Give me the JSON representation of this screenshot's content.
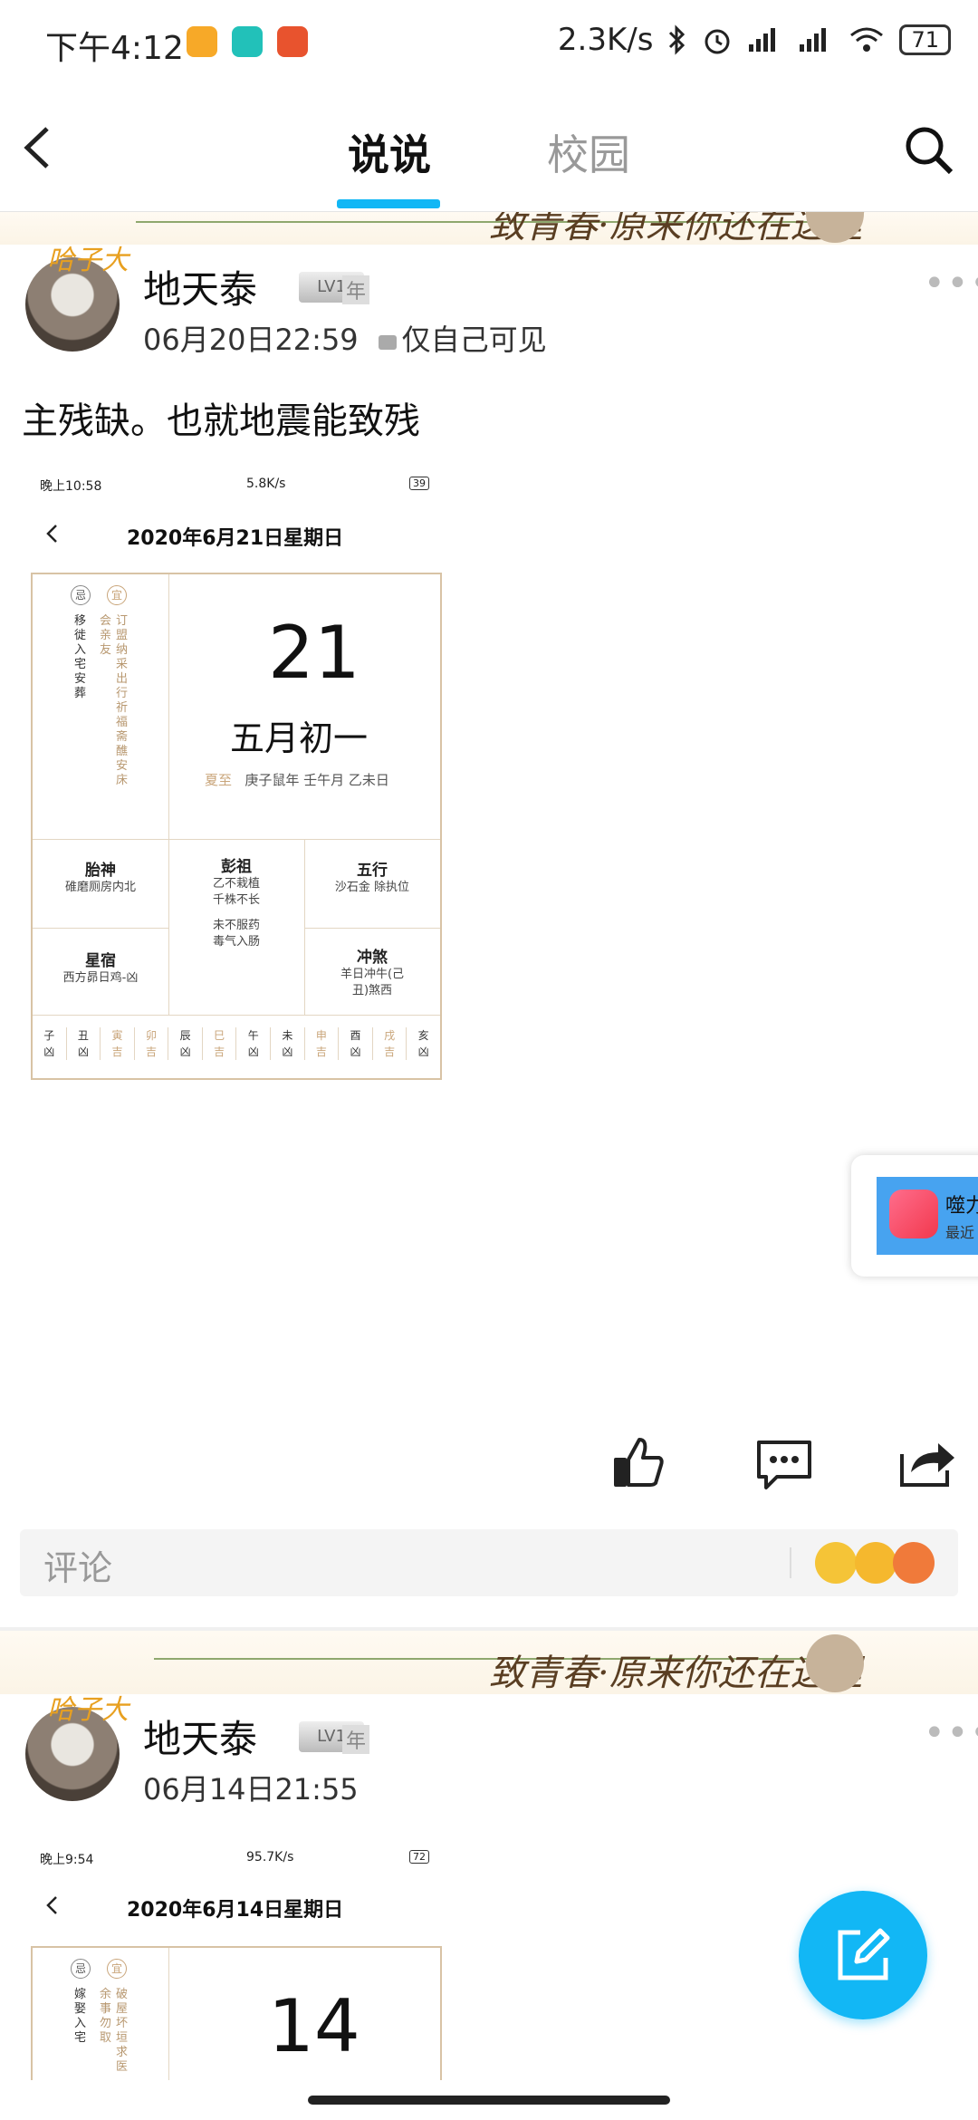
{
  "status_bar": {
    "time": "下午4:12",
    "speed": "2.3K/s",
    "battery": "71"
  },
  "nav": {
    "active_tab": "说说",
    "other_tab": "校园"
  },
  "banner": {
    "text": "致青春·原来你还在这里"
  },
  "posts": [
    {
      "user": "地天泰",
      "avatar_tag": "哈子大",
      "level": "LV1",
      "year_badge": "年",
      "time": "06月20日22:59",
      "visibility": "仅自己可见",
      "text": "主残缺。也就地震能致残",
      "screenshot": {
        "status_time": "晚上10:58",
        "status_speed": "5.8K/s",
        "status_battery": "39",
        "date_title": "2020年6月21日星期日",
        "avoid_label": "忌",
        "good_label": "宜",
        "avoid_items": "移徙入宅安葬",
        "good_items_1": "会亲友",
        "good_items_2": "订盟纳采出行祈福斋醮安床",
        "day": "21",
        "lunar": "五月初一",
        "solar_term": "夏至",
        "ganzhi": "庚子鼠年 壬午月 乙未日",
        "taishen_title": "胎神",
        "taishen_text": "碓磨厕房内北",
        "pengzu_title": "彭祖",
        "pengzu_text1": "乙不栽植",
        "pengzu_text2": "千株不长",
        "pengzu_text3": "未不服药",
        "pengzu_text4": "毒气入肠",
        "wuxing_title": "五行",
        "wuxing_text": "沙石金 除执位",
        "xingxiu_title": "星宿",
        "xingxiu_text": "西方昴日鸡-凶",
        "chongsha_title": "冲煞",
        "chongsha_text1": "羊日冲牛(己",
        "chongsha_text2": "丑)煞西",
        "hours": [
          {
            "h": "子",
            "v": "凶",
            "good": false
          },
          {
            "h": "丑",
            "v": "凶",
            "good": false
          },
          {
            "h": "寅",
            "v": "吉",
            "good": true
          },
          {
            "h": "卯",
            "v": "吉",
            "good": true
          },
          {
            "h": "辰",
            "v": "凶",
            "good": false
          },
          {
            "h": "巳",
            "v": "吉",
            "good": true
          },
          {
            "h": "午",
            "v": "凶",
            "good": false
          },
          {
            "h": "未",
            "v": "凶",
            "good": false
          },
          {
            "h": "申",
            "v": "吉",
            "good": true
          },
          {
            "h": "酉",
            "v": "凶",
            "good": false
          },
          {
            "h": "戌",
            "v": "吉",
            "good": true
          },
          {
            "h": "亥",
            "v": "凶",
            "good": false
          }
        ]
      }
    },
    {
      "user": "地天泰",
      "avatar_tag": "哈子大",
      "level": "LV1",
      "year_badge": "年",
      "time": "06月14日21:55",
      "screenshot": {
        "status_time": "晚上9:54",
        "status_speed": "95.7K/s",
        "status_battery": "72",
        "date_title": "2020年6月14日星期日",
        "avoid_label": "忌",
        "good_label": "宜",
        "avoid_items": "嫁娶入宅",
        "good_items_1": "余事勿取",
        "good_items_2": "破屋坏垣求医",
        "day": "14"
      }
    }
  ],
  "comment": {
    "placeholder": "评论"
  },
  "side_card": {
    "title": "噬力",
    "subtitle": "最近"
  },
  "icons": [
    "back-icon",
    "search-icon",
    "like-icon",
    "comment-icon",
    "share-icon",
    "edit-icon",
    "lock-icon",
    "more-icon",
    "bluetooth-icon",
    "alarm-icon",
    "signal-icon",
    "wifi-icon"
  ]
}
